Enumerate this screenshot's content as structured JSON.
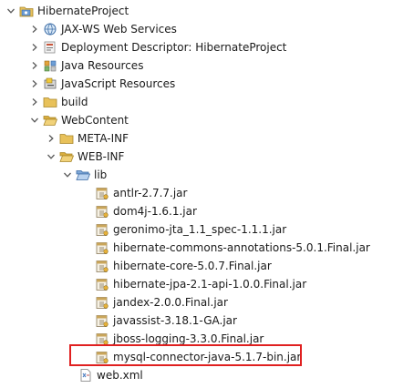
{
  "tree": {
    "project": {
      "label": "HibernateProject",
      "icon": "project-icon"
    },
    "jaxws": {
      "label": "JAX-WS Web Services",
      "icon": "web-services-icon"
    },
    "deployment": {
      "label": "Deployment Descriptor: HibernateProject",
      "icon": "deployment-descriptor-icon"
    },
    "java_resources": {
      "label": "Java Resources",
      "icon": "java-resources-icon"
    },
    "js_resources": {
      "label": "JavaScript Resources",
      "icon": "javascript-resources-icon"
    },
    "build": {
      "label": "build",
      "icon": "folder-icon"
    },
    "webcontent": {
      "label": "WebContent",
      "icon": "folder-open-icon"
    },
    "meta_inf": {
      "label": "META-INF",
      "icon": "folder-icon"
    },
    "web_inf": {
      "label": "WEB-INF",
      "icon": "folder-open-icon"
    },
    "lib": {
      "label": "lib",
      "icon": "folder-open-icon"
    },
    "jars": [
      "antlr-2.7.7.jar",
      "dom4j-1.6.1.jar",
      "geronimo-jta_1.1_spec-1.1.1.jar",
      "hibernate-commons-annotations-5.0.1.Final.jar",
      "hibernate-core-5.0.7.Final.jar",
      "hibernate-jpa-2.1-api-1.0.0.Final.jar",
      "jandex-2.0.0.Final.jar",
      "javassist-3.18.1-GA.jar",
      "jboss-logging-3.3.0.Final.jar",
      "mysql-connector-java-5.1.7-bin.jar"
    ],
    "web_xml": {
      "label": "web.xml",
      "icon": "xml-file-icon"
    }
  },
  "colors": {
    "highlight_border": "#e02020",
    "folder": "#e8c15a",
    "twistie": "#5a5a5a"
  }
}
